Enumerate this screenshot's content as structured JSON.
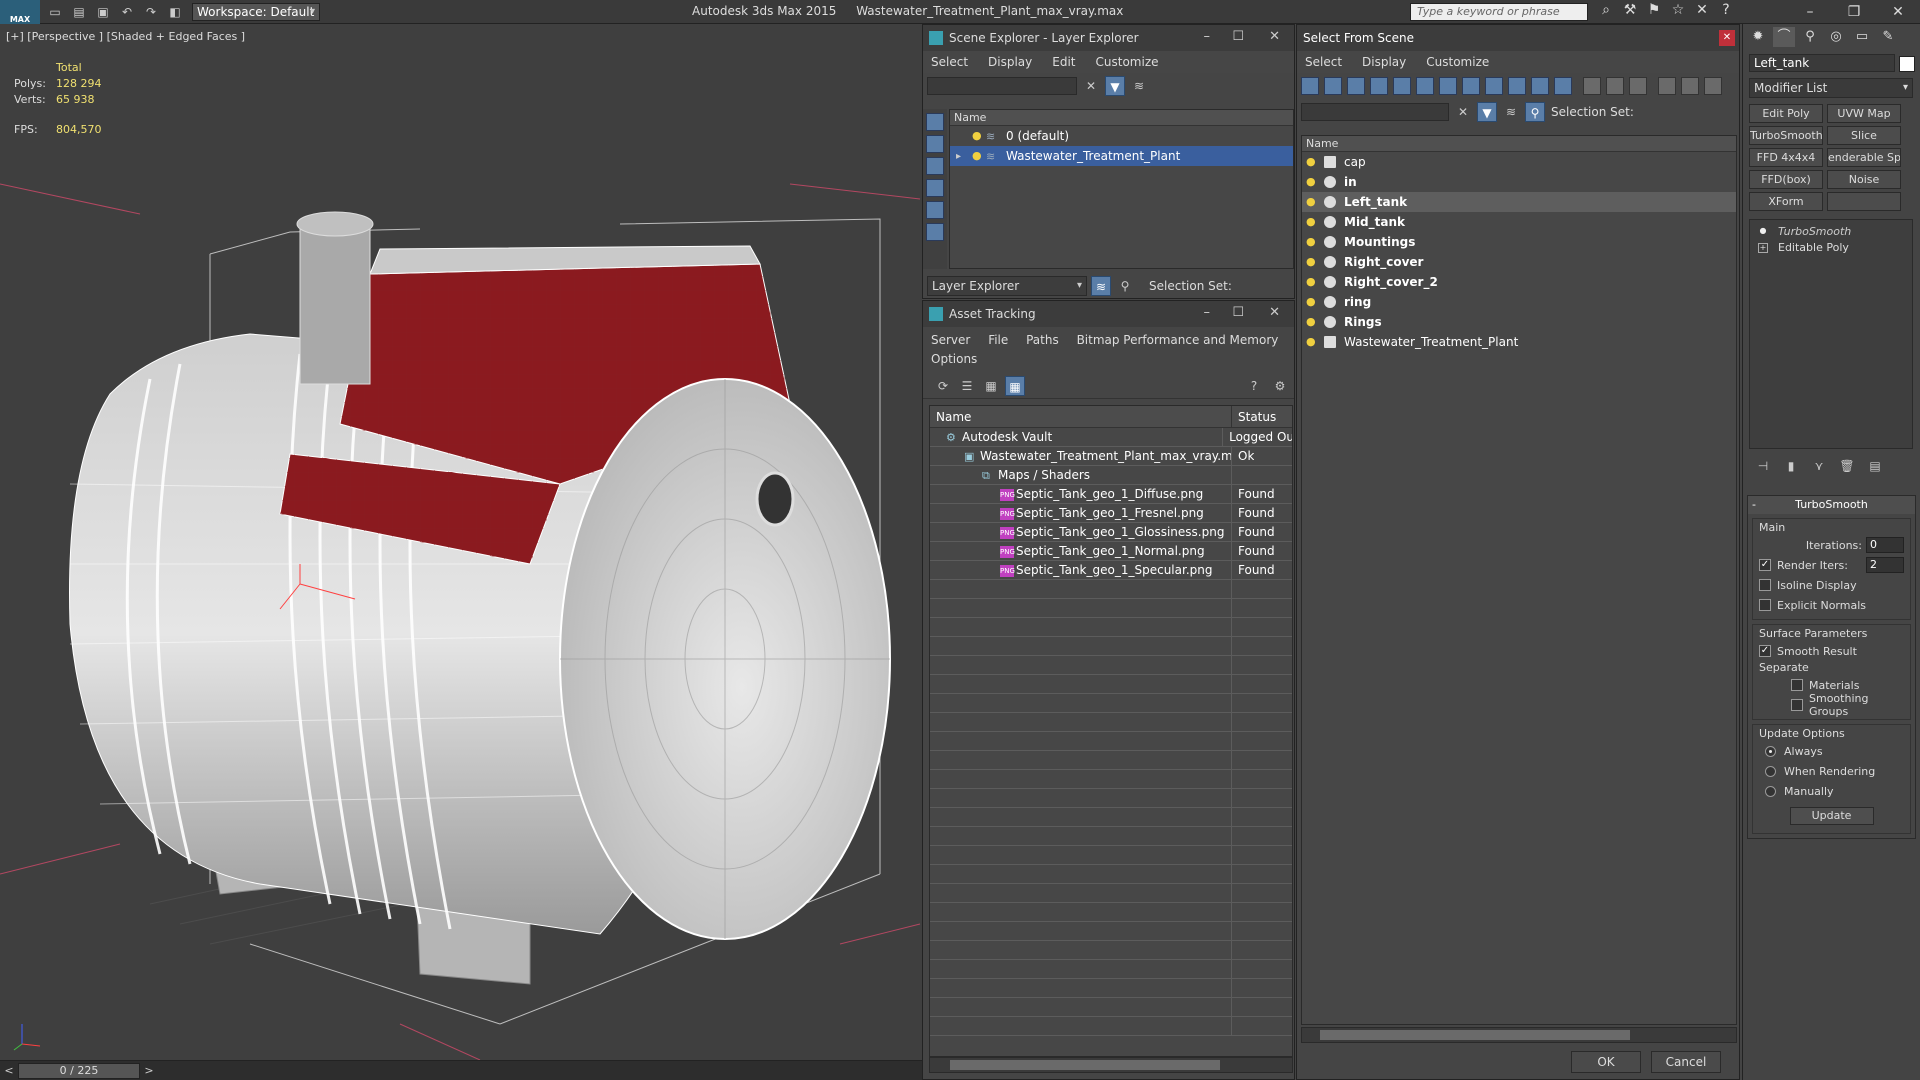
{
  "titlebar": {
    "logo": "MAX",
    "workspace": "Workspace: Default",
    "app_name": "Autodesk 3ds Max  2015",
    "file_name": "Wastewater_Treatment_Plant_max_vray.max",
    "search_placeholder": "Type a keyword or phrase"
  },
  "viewport": {
    "label": "[+] [Perspective ] [Shaded + Edged Faces ]",
    "stats_total": "Total",
    "polys_label": "Polys:",
    "polys_value": "128 294",
    "verts_label": "Verts:",
    "verts_value": "65 938",
    "fps_label": "FPS:",
    "fps_value": "804,570"
  },
  "timeline": {
    "frame": "0 / 225"
  },
  "scene_explorer": {
    "title": "Scene Explorer - Layer Explorer",
    "menu": [
      "Select",
      "Display",
      "Edit",
      "Customize"
    ],
    "column_name": "Name",
    "layers": [
      "0 (default)",
      "Wastewater_Treatment_Plant"
    ],
    "explorer_mode": "Layer Explorer",
    "selection_set": "Selection Set:"
  },
  "asset_tracking": {
    "title": "Asset Tracking",
    "menu_row1": [
      "Server",
      "File",
      "Paths",
      "Bitmap Performance and Memory"
    ],
    "menu_row2": [
      "Options"
    ],
    "col_name": "Name",
    "col_status": "Status",
    "rows": [
      {
        "name": "Autodesk Vault",
        "status": "Logged Ou"
      },
      {
        "name": "Wastewater_Treatment_Plant_max_vray.max",
        "status": "Ok"
      },
      {
        "name": "Maps / Shaders",
        "status": ""
      },
      {
        "name": "Septic_Tank_geo_1_Diffuse.png",
        "status": "Found"
      },
      {
        "name": "Septic_Tank_geo_1_Fresnel.png",
        "status": "Found"
      },
      {
        "name": "Septic_Tank_geo_1_Glossiness.png",
        "status": "Found"
      },
      {
        "name": "Septic_Tank_geo_1_Normal.png",
        "status": "Found"
      },
      {
        "name": "Septic_Tank_geo_1_Specular.png",
        "status": "Found"
      }
    ],
    "png_badge": "PNG"
  },
  "select_from_scene": {
    "title": "Select From Scene",
    "menu": [
      "Select",
      "Display",
      "Customize"
    ],
    "selection_set": "Selection Set:",
    "column_name": "Name",
    "objects": [
      "cap",
      "in",
      "Left_tank",
      "Mid_tank",
      "Mountings",
      "Right_cover",
      "Right_cover_2",
      "ring",
      "Rings",
      "Wastewater_Treatment_Plant"
    ],
    "ok_label": "OK",
    "cancel_label": "Cancel"
  },
  "command_panel": {
    "object_name": "Left_tank",
    "modifier_list": "Modifier List",
    "modifier_buttons": [
      "Edit Poly",
      "UVW Map",
      "TurboSmooth",
      "Slice",
      "FFD 4x4x4",
      "enderable Splin",
      "FFD(box)",
      "Noise",
      "XForm",
      ""
    ],
    "stack": [
      "TurboSmooth",
      "Editable Poly"
    ],
    "rollout_title": "TurboSmooth",
    "main_group": "Main",
    "iterations_label": "Iterations:",
    "iterations_value": "0",
    "render_iters_label": "Render Iters:",
    "render_iters_value": "2",
    "isoline_label": "Isoline Display",
    "explicit_normals_label": "Explicit Normals",
    "surface_group": "Surface Parameters",
    "smooth_result_label": "Smooth Result",
    "separate_label": "Separate",
    "materials_label": "Materials",
    "smoothing_groups_label": "Smoothing Groups",
    "update_group": "Update Options",
    "always_label": "Always",
    "when_rendering_label": "When Rendering",
    "manually_label": "Manually",
    "update_button": "Update"
  },
  "colors": {
    "selection_blue": "#3a5f9e",
    "accent_red": "#8b1a1f",
    "stats_yellow": "#f0e070"
  }
}
